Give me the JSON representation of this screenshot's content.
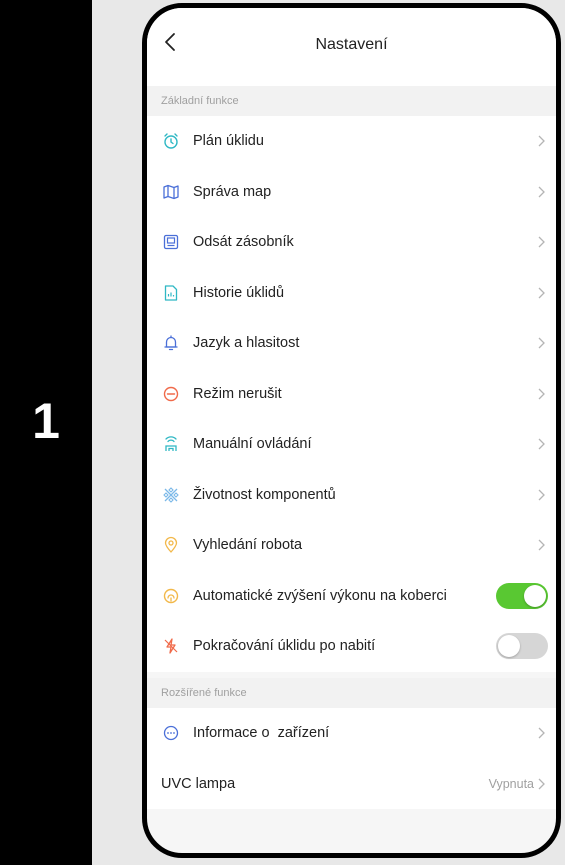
{
  "step_number": "1",
  "header": {
    "title": "Nastavení"
  },
  "sections": {
    "basic": {
      "label": "Základní funkce"
    },
    "extended": {
      "label": "Rozšířené funkce"
    }
  },
  "basic_items": [
    {
      "label": "Plán úklidu",
      "icon": "alarm-clock-icon",
      "color": "#2fb8c4"
    },
    {
      "label": "Správa map",
      "icon": "map-icon",
      "color": "#4a6fd8"
    },
    {
      "label": "Odsát zásobník",
      "icon": "dustbin-icon",
      "color": "#4a6fd8"
    },
    {
      "label": "Historie úklidů",
      "icon": "history-document-icon",
      "color": "#2fb8c4"
    },
    {
      "label": "Jazyk a hlasitost",
      "icon": "bell-icon",
      "color": "#4a6fd8"
    },
    {
      "label": "Režim nerušit",
      "icon": "do-not-disturb-icon",
      "color": "#f06a4a"
    },
    {
      "label": "Manuální ovládání",
      "icon": "remote-control-icon",
      "color": "#2fb8c4"
    },
    {
      "label": "Životnost komponentů",
      "icon": "components-icon",
      "color": "#7bb8e8"
    },
    {
      "label": "Vyhledání robota",
      "icon": "location-pin-icon",
      "color": "#f2b84a"
    },
    {
      "label": "Automatické zvýšení výkonu na koberci",
      "icon": "carpet-boost-icon",
      "color": "#f2b84a",
      "toggle": true,
      "on": true
    },
    {
      "label": "Pokračování úklidu po nabití",
      "icon": "charging-icon",
      "color": "#f06a4a",
      "toggle": true,
      "on": false
    }
  ],
  "extended_items": [
    {
      "label": "Informace o  zařízení",
      "icon": "info-dots-icon",
      "color": "#4a6fd8"
    },
    {
      "label": "UVC lampa",
      "value": "Vypnuta"
    }
  ],
  "colors": {
    "toggle_on": "#59c832",
    "toggle_off": "#d6d6d6"
  }
}
